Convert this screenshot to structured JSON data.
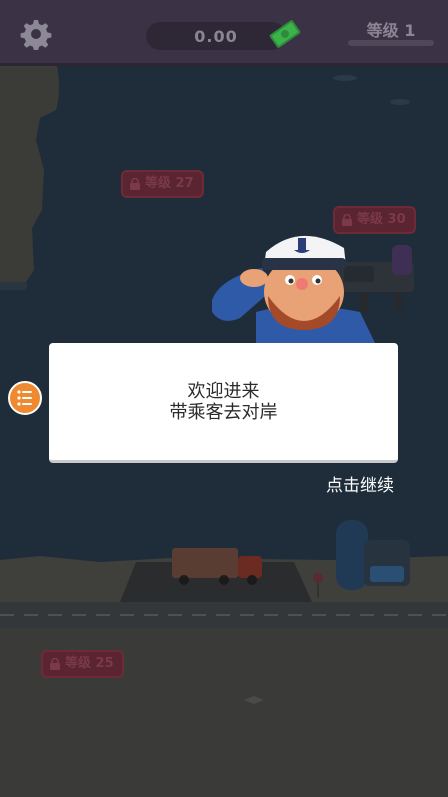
{
  "top_bar": {
    "settings_icon": "gear-icon",
    "money_value": "0.00",
    "money_icon": "cash-bundle-icon",
    "level_label": "等级 1",
    "level_progress": 0
  },
  "locked_areas": [
    {
      "label": "等级 27"
    },
    {
      "label": "等级 30"
    },
    {
      "label": "等级 25"
    }
  ],
  "dialog": {
    "line1": "欢迎进来",
    "line2": "带乘客去对岸"
  },
  "continue_hint": "点击继续",
  "side_menu": {
    "icon": "list-icon"
  },
  "colors": {
    "top_bar": "#3c3245",
    "water": "#1e2d39",
    "lock_badge": "#5a2530",
    "menu_button": "#f08a30",
    "cash_green": "#3bb24a"
  }
}
